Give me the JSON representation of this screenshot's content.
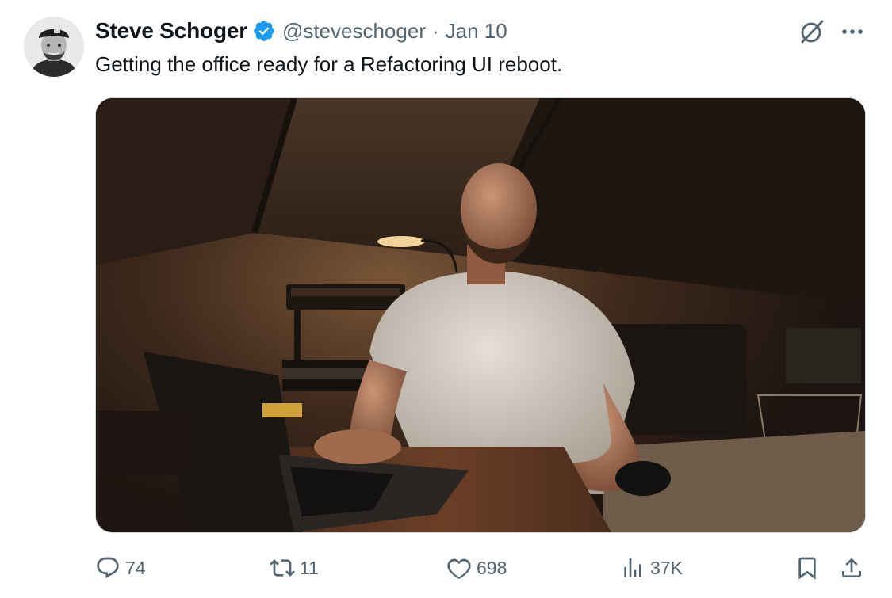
{
  "author": {
    "name": "Steve Schoger",
    "handle": "@steveschoger",
    "separator": "·",
    "date": "Jan 10",
    "verified": true
  },
  "tweet_text": "Getting the office ready for a Refactoring UI reboot.",
  "icons": {
    "verified": "verified-badge-icon",
    "grok": "grok-icon",
    "more": "more-icon",
    "reply": "reply-icon",
    "retweet": "retweet-icon",
    "like": "heart-icon",
    "views": "views-chart-icon",
    "bookmark": "bookmark-icon",
    "share": "share-icon"
  },
  "actions": {
    "replies": "74",
    "retweets": "11",
    "likes": "698",
    "views": "37K"
  },
  "colors": {
    "text_primary": "#0f1419",
    "text_secondary": "#536471",
    "verified_blue": "#1d9bf0",
    "border": "#cfd9de"
  }
}
